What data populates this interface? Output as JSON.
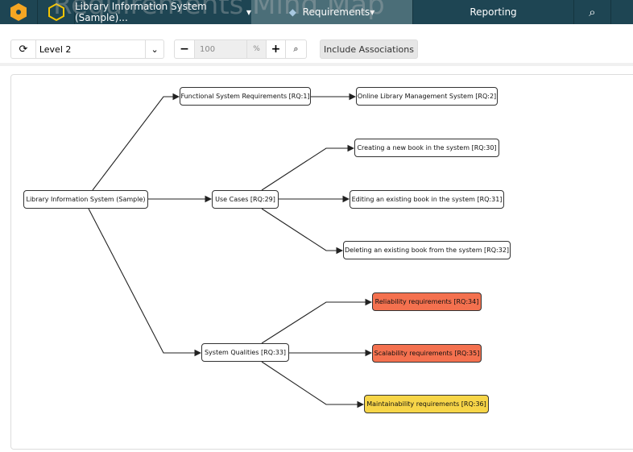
{
  "header": {
    "project": "Library Information System (Sample)...",
    "requirements": "Requirements",
    "reporting": "Reporting",
    "bg_title": "Requirements Mind Map"
  },
  "toolbar": {
    "level": "Level 2",
    "zoom": "100",
    "percent": "%",
    "include_associations": "Include Associations"
  },
  "nodes": {
    "root": "Library Information System (Sample)",
    "fsr": "Functional System Requirements [RQ:1]",
    "olms": "Online Library Management System [RQ:2]",
    "uc": "Use Cases [RQ:29]",
    "new": "Creating a new book in the system [RQ:30]",
    "edit": "Editing an existing book in the system [RQ:31]",
    "del": "Deleting an existing book from the system [RQ:32]",
    "sq": "System Qualities [RQ:33]",
    "rel": "Reliability requirements [RQ:34]",
    "scal": "Scalability requirements [RQ:35]",
    "maint": "Maintainability requirements [RQ:36]"
  },
  "colors": {
    "header": "#1e4553",
    "active_tab": "#4b6e78",
    "high": "#f4714f",
    "medium": "#f7d548"
  }
}
